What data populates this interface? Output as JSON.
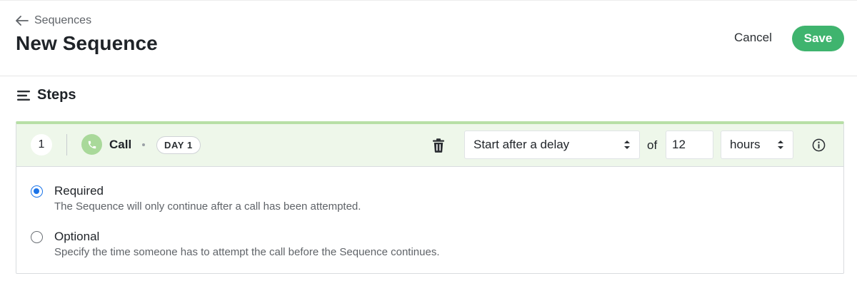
{
  "header": {
    "back_label": "Sequences",
    "title": "New Sequence",
    "cancel_label": "Cancel",
    "save_label": "Save"
  },
  "steps": {
    "heading": "Steps",
    "step": {
      "number": "1",
      "type": "Call",
      "day_badge": "DAY 1",
      "timing_select": "Start after a delay",
      "of_label": "of",
      "delay_value": "12",
      "unit_select": "hours",
      "options": [
        {
          "label": "Required",
          "description": "The Sequence will only continue after a call has been attempted.",
          "checked": true
        },
        {
          "label": "Optional",
          "description": "Specify the time someone has to attempt the call before the Sequence continues.",
          "checked": false
        }
      ]
    }
  },
  "colors": {
    "accent_green": "#3fb46e",
    "step_header_bg": "#eef7ea",
    "step_header_bar": "#b7dfa6",
    "call_icon_bg": "#a9d99a",
    "radio_blue": "#1a73e8"
  },
  "icons": [
    "arrow-left-icon",
    "list-icon",
    "phone-icon",
    "trash-icon",
    "select-arrows-icon",
    "info-icon"
  ]
}
